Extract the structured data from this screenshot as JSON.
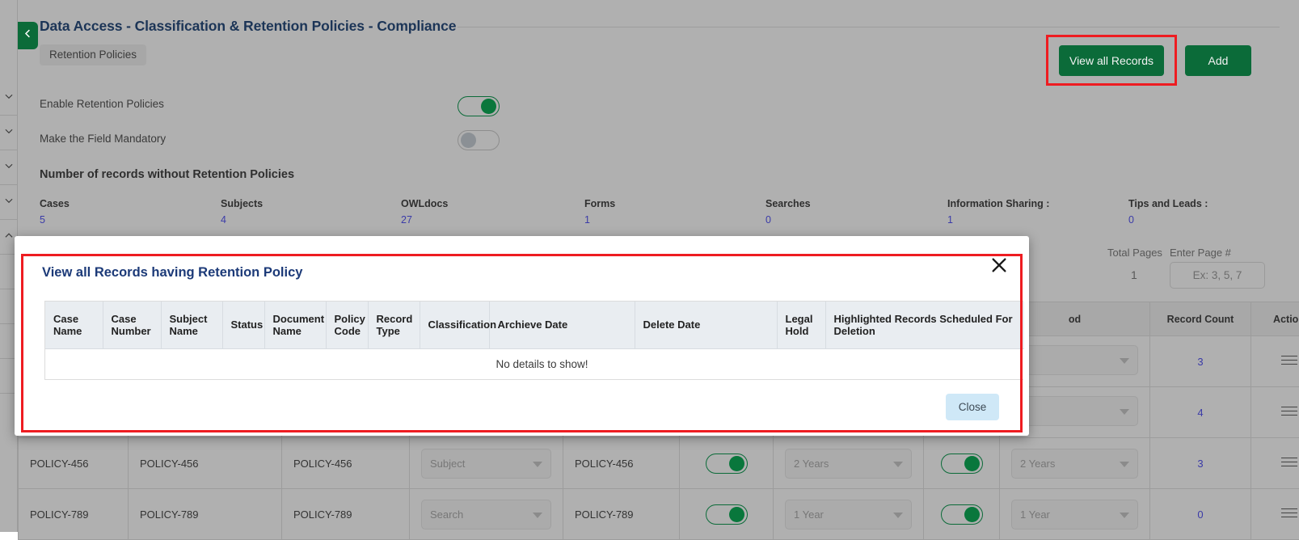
{
  "header": {
    "title": "Data Access - Classification & Retention Policies - Compliance",
    "tab_label": "Retention Policies",
    "back_icon": "chevron-left-icon"
  },
  "toolbar": {
    "view_all_records_label": "View all Records",
    "add_label": "Add"
  },
  "settings": {
    "enable_retention_label": "Enable Retention Policies",
    "enable_retention_state": "on",
    "mandatory_label": "Make the Field Mandatory",
    "mandatory_state": "off"
  },
  "stats": {
    "heading": "Number of records without Retention Policies",
    "items": [
      {
        "label": "Cases",
        "value": "5"
      },
      {
        "label": "Subjects",
        "value": "4"
      },
      {
        "label": "OWLdocs",
        "value": "27"
      },
      {
        "label": "Forms",
        "value": "1"
      },
      {
        "label": "Searches",
        "value": "0"
      },
      {
        "label": "Information Sharing :",
        "value": "1"
      },
      {
        "label": "Tips and Leads :",
        "value": "0"
      }
    ]
  },
  "pagination": {
    "total_pages_label": "Total Pages",
    "total_pages_value": "1",
    "enter_page_label": "Enter Page #",
    "enter_page_placeholder": "Ex: 3, 5, 7",
    "enter_page_value": ""
  },
  "background_table": {
    "columns": [
      "",
      "",
      "",
      "",
      "",
      "",
      "",
      "",
      "od",
      "Record Count",
      "Action"
    ],
    "visible_headers": {
      "period": "od",
      "record_count": "Record Count",
      "action": "Action"
    },
    "rows": [
      {
        "c1": "",
        "c2": "",
        "c3": "",
        "select1": "",
        "c5": "",
        "toggle1": "on",
        "select2": "",
        "toggle2": "on",
        "select3": "",
        "record_count": "3",
        "action_icon": "hamburger-icon"
      },
      {
        "c1": "",
        "c2": "",
        "c3": "",
        "select1": "",
        "c5": "",
        "toggle1": "on",
        "select2": "",
        "toggle2": "on",
        "select3": "",
        "record_count": "4",
        "action_icon": "hamburger-icon"
      },
      {
        "c1": "POLICY-456",
        "c2": "POLICY-456",
        "c3": "POLICY-456",
        "select1": "Subject",
        "c5": "POLICY-456",
        "toggle1": "on",
        "select2": "2 Years",
        "toggle2": "on",
        "select3": "2 Years",
        "record_count": "3",
        "action_icon": "hamburger-icon"
      },
      {
        "c1": "POLICY-789",
        "c2": "POLICY-789",
        "c3": "POLICY-789",
        "select1": "Search",
        "c5": "POLICY-789",
        "toggle1": "on",
        "select2": "1 Year",
        "toggle2": "on",
        "select3": "1 Year",
        "record_count": "0",
        "action_icon": "hamburger-icon"
      }
    ]
  },
  "modal": {
    "title": "View all Records having Retention Policy",
    "close_icon": "close-x-icon",
    "columns": [
      "Case Name",
      "Case Number",
      "Subject Name",
      "Status",
      "Document Name",
      "Policy Code",
      "Record Type",
      "Classification",
      "Archieve Date",
      "Delete Date",
      "Legal Hold",
      "Highlighted Records Scheduled For Deletion"
    ],
    "empty_message": "No details to show!",
    "close_button_label": "Close"
  },
  "colors": {
    "brand_green": "#0b6b39",
    "annotation_red": "#ee1c21",
    "title_navy": "#1c3557",
    "link_blue": "#3b3ba8",
    "close_btn_blue": "#cfe8f7",
    "table_header_gray": "#e9edf1"
  }
}
